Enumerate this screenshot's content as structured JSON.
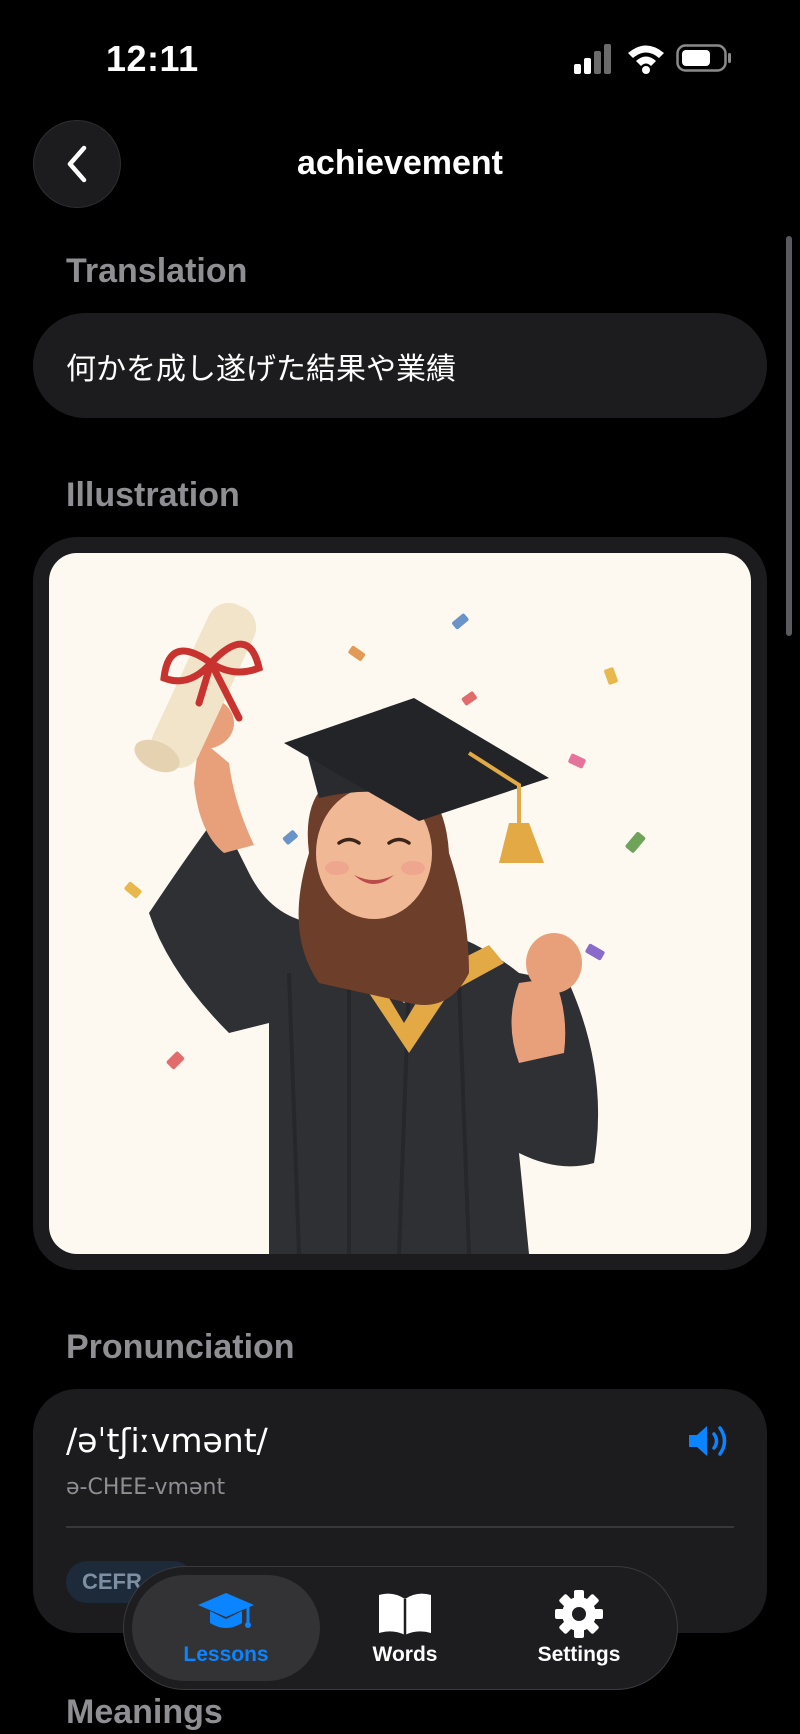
{
  "status_bar": {
    "time": "12:11"
  },
  "header": {
    "back_icon": "chevron-left-icon",
    "title": "achievement"
  },
  "translation": {
    "label": "Translation",
    "text": "何かを成し遂げた結果や業績"
  },
  "illustration": {
    "label": "Illustration",
    "image_subject": "graduate-celebrating-image"
  },
  "pronunciation": {
    "label": "Pronunciation",
    "ipa": "/əˈtʃiːvmənt/",
    "respelling": "ə-CHEE-vmənt",
    "speaker_icon": "speaker-wave-icon",
    "cefr_label": "CEFR"
  },
  "meanings": {
    "label": "Meanings"
  },
  "tab_bar": {
    "tabs": [
      {
        "label": "Lessons",
        "icon": "graduation-cap-icon",
        "active": true
      },
      {
        "label": "Words",
        "icon": "book-icon",
        "active": false
      },
      {
        "label": "Settings",
        "icon": "gear-icon",
        "active": false
      }
    ]
  },
  "colors": {
    "accent": "#0a84ff",
    "background": "#000000",
    "card": "#1c1c1e",
    "secondary_text": "#8e8e93"
  }
}
